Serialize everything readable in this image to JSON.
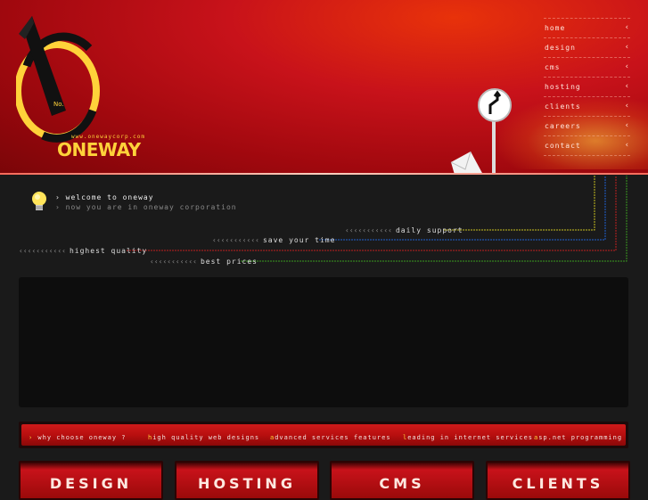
{
  "brand": {
    "url": "www.onewaycorp.com",
    "name": "ONEWAY",
    "badge": "No."
  },
  "nav": {
    "items": [
      {
        "label": "home"
      },
      {
        "label": "design"
      },
      {
        "label": "cms"
      },
      {
        "label": "hosting"
      },
      {
        "label": "clients"
      },
      {
        "label": "careers"
      },
      {
        "label": "contact"
      }
    ],
    "arrow": "‹"
  },
  "welcome": {
    "line1": "› welcome to oneway",
    "line2": "› now you are in oneway corporation"
  },
  "features": [
    {
      "dots": "‹‹‹‹‹‹‹‹‹‹‹",
      "label": "daily support"
    },
    {
      "dots": "‹‹‹‹‹‹‹‹‹‹‹",
      "label": "save your time"
    },
    {
      "dots": "‹‹‹‹‹‹‹‹‹‹‹",
      "label": "highest quality"
    },
    {
      "dots": "‹‹‹‹‹‹‹‹‹‹‹",
      "label": "best prices"
    }
  ],
  "redbar": {
    "items": [
      {
        "first": "›",
        "rest": " why choose oneway ?"
      },
      {
        "first": "h",
        "rest": "igh quality web designs"
      },
      {
        "first": "a",
        "rest": "dvanced services features"
      },
      {
        "first": "l",
        "rest": "eading in internet services"
      },
      {
        "first": "a",
        "rest": "sp.net programming"
      }
    ]
  },
  "boxes": [
    {
      "label": "DESIGN"
    },
    {
      "label": "HOSTING"
    },
    {
      "label": "CMS"
    },
    {
      "label": "CLIENTS"
    }
  ],
  "colors": {
    "accent_yellow": "#ffd23a",
    "header_red": "#c8121a",
    "line_yellow": "#c8c020",
    "line_blue": "#2060d0",
    "line_red": "#c02020",
    "line_green": "#3a9a20"
  }
}
